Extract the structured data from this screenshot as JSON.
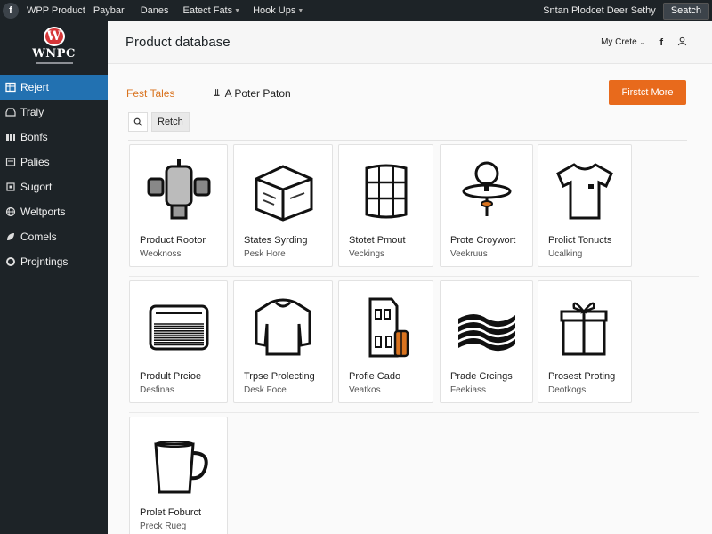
{
  "admin_bar": {
    "logo_glyph": "f",
    "items": [
      "WPP Product",
      "Paybar",
      "Danes",
      "Eatect Fats",
      "Hook Ups"
    ],
    "greeting": "Sntan Plodcet Deer Sethy",
    "search_label": "Seatch"
  },
  "sidebar": {
    "brand_initial": "W",
    "brand_name": "WNPC",
    "items": [
      {
        "label": "Rejert",
        "icon": "table-icon",
        "active": true
      },
      {
        "label": "Traly",
        "icon": "tray-icon",
        "active": false
      },
      {
        "label": "Bonfs",
        "icon": "books-icon",
        "active": false
      },
      {
        "label": "Palies",
        "icon": "page-icon",
        "active": false
      },
      {
        "label": "Sugort",
        "icon": "support-icon",
        "active": false
      },
      {
        "label": "Weltports",
        "icon": "globe-icon",
        "active": false
      },
      {
        "label": "Comels",
        "icon": "leaf-icon",
        "active": false
      },
      {
        "label": "Projntings",
        "icon": "circle-icon",
        "active": false
      }
    ]
  },
  "page": {
    "title": "Product database",
    "user_menu": "My Crete",
    "social_glyph": "f"
  },
  "toolbar": {
    "featured_tab": "Fest Tales",
    "filter_tab": "A Poter Paton",
    "primary_button": "Firstct More"
  },
  "search": {
    "button_label": "Retch"
  },
  "colors": {
    "accent_orange": "#e86a1c",
    "sidebar_active": "#2271b1",
    "sidebar_bg": "#1d2327"
  },
  "products": [
    {
      "title": "Product Rootor",
      "subtitle": "Weoknoss",
      "icon": "valve-icon"
    },
    {
      "title": "States Syrding",
      "subtitle": "Pesk Hore",
      "icon": "box-icon"
    },
    {
      "title": "Stotet Pmout",
      "subtitle": "Veckings",
      "icon": "barrel-icon"
    },
    {
      "title": "Prote Croywort",
      "subtitle": "Veekruus",
      "icon": "lamp-icon"
    },
    {
      "title": "Prolict Tonucts",
      "subtitle": "Ucalking",
      "icon": "tshirt-icon"
    },
    {
      "title": "Prodult Prcioe",
      "subtitle": "Desfinas",
      "icon": "radiator-icon"
    },
    {
      "title": "Trpse Prolecting",
      "subtitle": "Desk Foce",
      "icon": "sweater-icon"
    },
    {
      "title": "Profie Cado",
      "subtitle": "Veatkos",
      "icon": "building-icon"
    },
    {
      "title": "Prade Crcings",
      "subtitle": "Feekiass",
      "icon": "waves-icon"
    },
    {
      "title": "Prosest Proting",
      "subtitle": "Deotkogs",
      "icon": "gift-icon"
    },
    {
      "title": "Prolet Foburct",
      "subtitle": "Preck Rueg",
      "icon": "mug-icon"
    }
  ]
}
